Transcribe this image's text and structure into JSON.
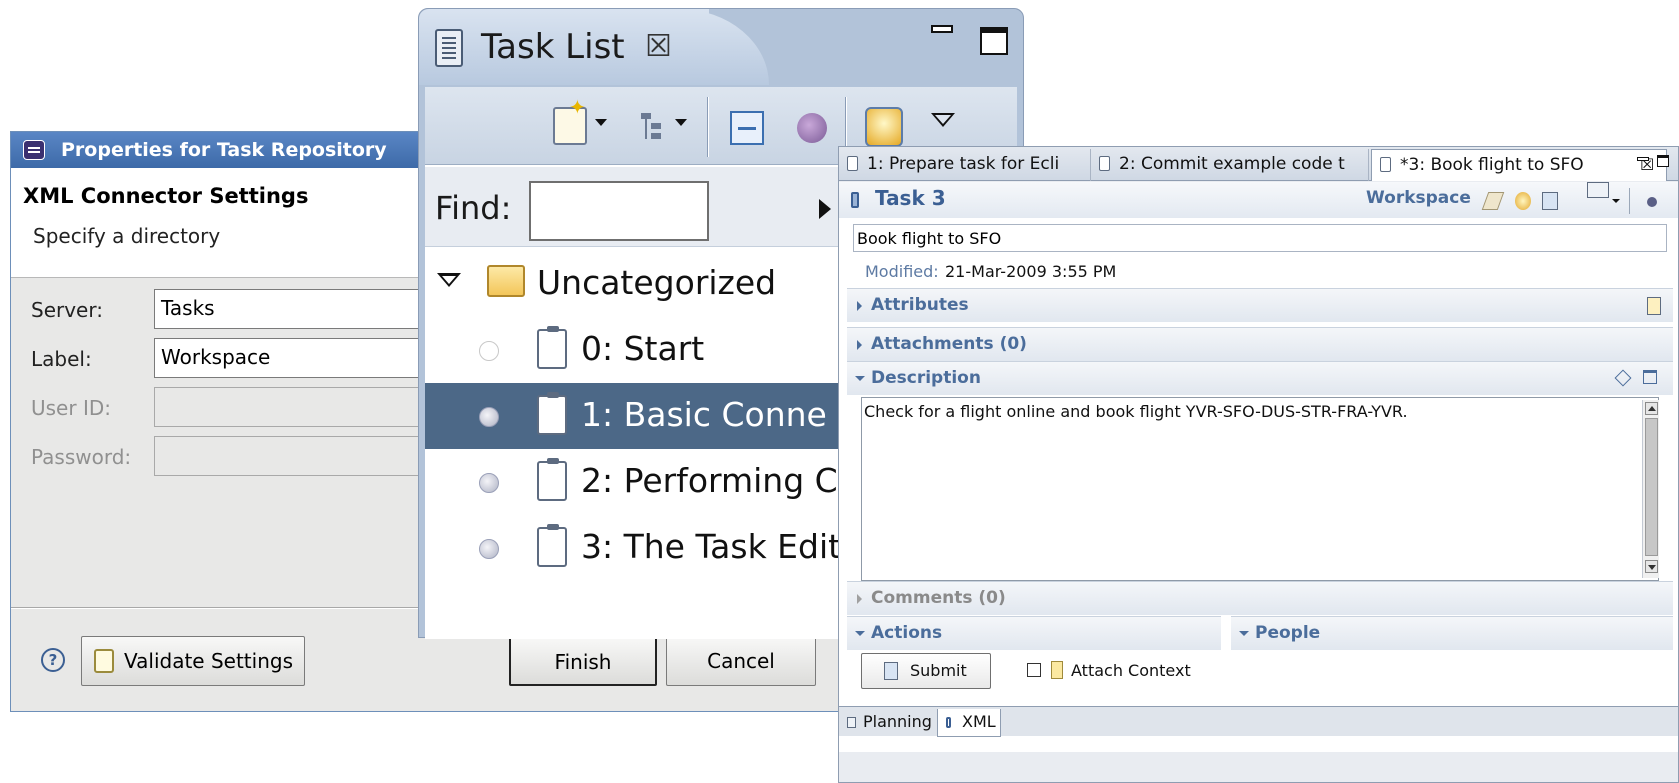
{
  "dialog": {
    "title": "Properties for Task Repository",
    "header_title": "XML Connector Settings",
    "header_message": "Specify a directory",
    "fields": {
      "server": {
        "label": "Server:",
        "value": "Tasks"
      },
      "label": {
        "label": "Label:",
        "value": "Workspace"
      },
      "user_id": {
        "label": "User ID:",
        "value": ""
      },
      "password": {
        "label": "Password:",
        "value": ""
      }
    },
    "validate_label": "Validate Settings",
    "finish_label": "Finish",
    "cancel_label": "Cancel"
  },
  "tasklist": {
    "tab_title": "Task List",
    "tab_close": "☒",
    "find_label": "Find:",
    "find_value": "",
    "category": "Uncategorized",
    "tasks": [
      {
        "label": "0: Start",
        "state": "incomplete"
      },
      {
        "label": "1: Basic Conne",
        "state": "active",
        "selected": true
      },
      {
        "label": "2: Performing C",
        "state": "incomplete"
      },
      {
        "label": "3: The Task Edit",
        "state": "incomplete"
      }
    ]
  },
  "editor": {
    "tabs": [
      {
        "label": "1: Prepare task for Ecli"
      },
      {
        "label": "2: Commit example code t"
      },
      {
        "label": "*3: Book flight to SFO",
        "active": true
      }
    ],
    "tab_close": "☒",
    "task_title": "Task 3",
    "repository": "Workspace",
    "summary": "Book flight to SFO",
    "modified_label": "Modified:",
    "modified_value": "21-Mar-2009 3:55 PM",
    "sections": {
      "attributes": "Attributes",
      "attachments": "Attachments (0)",
      "description": "Description",
      "comments": "Comments (0)",
      "actions": "Actions",
      "people": "People"
    },
    "description_text": "Check for a flight online and book flight YVR-SFO-DUS-STR-FRA-YVR.",
    "submit_label": "Submit",
    "attach_context_label": "Attach Context",
    "attach_context_checked": false,
    "bottom_tabs": [
      {
        "label": "Planning"
      },
      {
        "label": "XML",
        "active": true
      }
    ]
  },
  "colors": {
    "dialog_title_bar": "#3d6aa8",
    "selection": "#4c6887",
    "section_title": "#4b6d9b"
  }
}
